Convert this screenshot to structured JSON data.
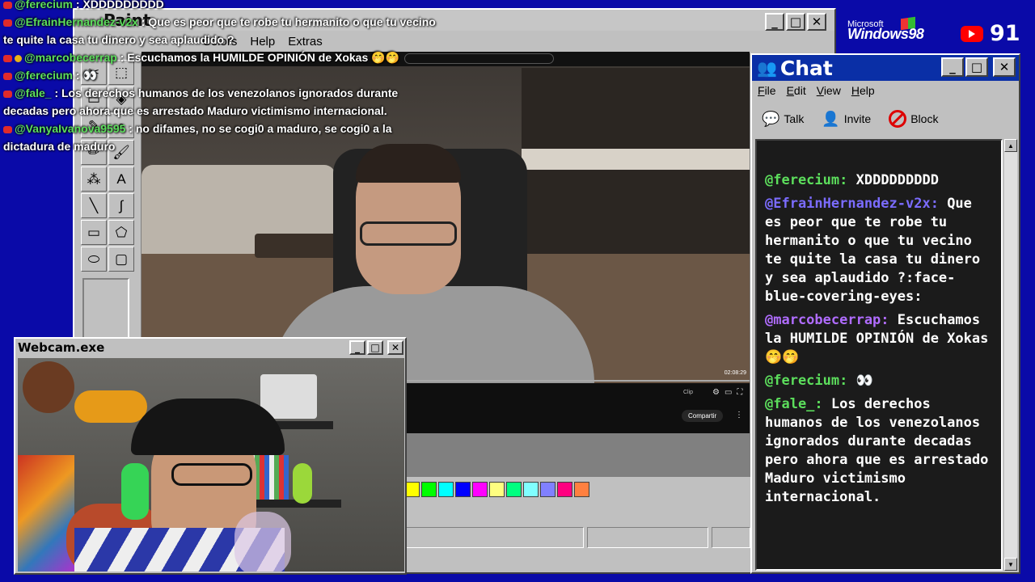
{
  "paint": {
    "title": "Paint",
    "menu": [
      "Colors",
      "Help",
      "Extras"
    ],
    "palette": [
      "#ffff00",
      "#00ff00",
      "#00ffff",
      "#0000ff",
      "#ff00ff",
      "#ffff80",
      "#00ff80",
      "#80ffff",
      "#8080ff",
      "#ff0080",
      "#ff8040"
    ],
    "window_buttons": {
      "minimize": "_",
      "maximize": "□",
      "close": "✕"
    }
  },
  "video": {
    "time": "02:08:29",
    "clip_label": "Clip",
    "share_label": "Compartir"
  },
  "overlay_chat": [
    {
      "user": "@ferecium",
      "text": " : XDDDDDDDDD"
    },
    {
      "user": "@EfrainHernandez-v2x",
      "text": " : Que es peor que te robe tu hermanito o que tu vecino te quite la casa tu dinero y sea aplaudido ?"
    },
    {
      "user": "@marcobecerrap",
      "text": " : Escuchamos la HUMILDE OPINIÓN de Xokas 🤭🤭"
    },
    {
      "user": "@ferecium",
      "text": " : 👀"
    },
    {
      "user": "@fale_",
      "text": " : Los derechos humanos de los venezolanos ignorados durante decadas pero ahora que es arrestado Maduro victimismo internacional."
    },
    {
      "user": "@VanyaIvanova9595",
      "text": " : no difames, no se cogi0 a maduro, se cogi0 a la dictadura de maduro"
    }
  ],
  "brand": {
    "microsoft": "Microsoft",
    "windows": "Windows98",
    "viewer_count": "91"
  },
  "chat": {
    "title": "Chat",
    "menu": [
      "File",
      "Edit",
      "View",
      "Help"
    ],
    "tools": {
      "talk": "Talk",
      "invite": "Invite",
      "block": "Block"
    },
    "messages": [
      {
        "user": "@ferecium:",
        "text": "XDDDDDDDDD",
        "color": "#5cde5c"
      },
      {
        "user": "@EfrainHernandez-v2x:",
        "text": "Que es peor que te robe tu hermanito o que tu vecino te quite la casa tu dinero y sea aplaudido ?:face-blue-covering-eyes:",
        "color": "#7b6cff"
      },
      {
        "user": "@marcobecerrap:",
        "text": "Escuchamos la HUMILDE OPINIÓN de Xokas 🤭🤭",
        "color": "#b06cff"
      },
      {
        "user": "@ferecium:",
        "text": "👀",
        "color": "#5cde5c"
      },
      {
        "user": "@fale_:",
        "text": "Los derechos humanos de los venezolanos ignorados durante decadas pero ahora que es arrestado Maduro victimismo internacional.",
        "color": "#5cde5c"
      }
    ]
  },
  "webcam": {
    "title": "Webcam.exe"
  },
  "colors": {
    "desktop": "#0a0aa8",
    "chat_title_bar": "#0a2fa6",
    "chat_bg": "#1b1b1b"
  }
}
